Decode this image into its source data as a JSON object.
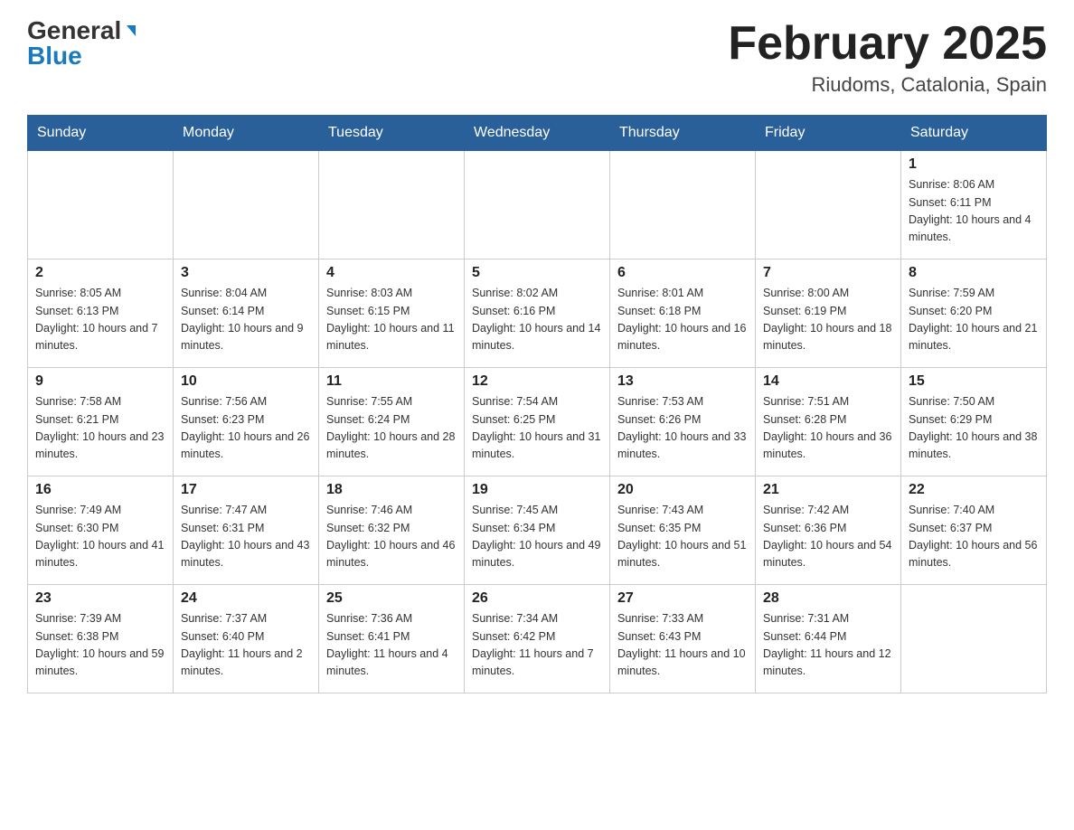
{
  "header": {
    "logo_general": "General",
    "logo_blue": "Blue",
    "month_title": "February 2025",
    "location": "Riudoms, Catalonia, Spain"
  },
  "days_of_week": [
    "Sunday",
    "Monday",
    "Tuesday",
    "Wednesday",
    "Thursday",
    "Friday",
    "Saturday"
  ],
  "weeks": [
    [
      {
        "day": "",
        "info": ""
      },
      {
        "day": "",
        "info": ""
      },
      {
        "day": "",
        "info": ""
      },
      {
        "day": "",
        "info": ""
      },
      {
        "day": "",
        "info": ""
      },
      {
        "day": "",
        "info": ""
      },
      {
        "day": "1",
        "info": "Sunrise: 8:06 AM\nSunset: 6:11 PM\nDaylight: 10 hours and 4 minutes."
      }
    ],
    [
      {
        "day": "2",
        "info": "Sunrise: 8:05 AM\nSunset: 6:13 PM\nDaylight: 10 hours and 7 minutes."
      },
      {
        "day": "3",
        "info": "Sunrise: 8:04 AM\nSunset: 6:14 PM\nDaylight: 10 hours and 9 minutes."
      },
      {
        "day": "4",
        "info": "Sunrise: 8:03 AM\nSunset: 6:15 PM\nDaylight: 10 hours and 11 minutes."
      },
      {
        "day": "5",
        "info": "Sunrise: 8:02 AM\nSunset: 6:16 PM\nDaylight: 10 hours and 14 minutes."
      },
      {
        "day": "6",
        "info": "Sunrise: 8:01 AM\nSunset: 6:18 PM\nDaylight: 10 hours and 16 minutes."
      },
      {
        "day": "7",
        "info": "Sunrise: 8:00 AM\nSunset: 6:19 PM\nDaylight: 10 hours and 18 minutes."
      },
      {
        "day": "8",
        "info": "Sunrise: 7:59 AM\nSunset: 6:20 PM\nDaylight: 10 hours and 21 minutes."
      }
    ],
    [
      {
        "day": "9",
        "info": "Sunrise: 7:58 AM\nSunset: 6:21 PM\nDaylight: 10 hours and 23 minutes."
      },
      {
        "day": "10",
        "info": "Sunrise: 7:56 AM\nSunset: 6:23 PM\nDaylight: 10 hours and 26 minutes."
      },
      {
        "day": "11",
        "info": "Sunrise: 7:55 AM\nSunset: 6:24 PM\nDaylight: 10 hours and 28 minutes."
      },
      {
        "day": "12",
        "info": "Sunrise: 7:54 AM\nSunset: 6:25 PM\nDaylight: 10 hours and 31 minutes."
      },
      {
        "day": "13",
        "info": "Sunrise: 7:53 AM\nSunset: 6:26 PM\nDaylight: 10 hours and 33 minutes."
      },
      {
        "day": "14",
        "info": "Sunrise: 7:51 AM\nSunset: 6:28 PM\nDaylight: 10 hours and 36 minutes."
      },
      {
        "day": "15",
        "info": "Sunrise: 7:50 AM\nSunset: 6:29 PM\nDaylight: 10 hours and 38 minutes."
      }
    ],
    [
      {
        "day": "16",
        "info": "Sunrise: 7:49 AM\nSunset: 6:30 PM\nDaylight: 10 hours and 41 minutes."
      },
      {
        "day": "17",
        "info": "Sunrise: 7:47 AM\nSunset: 6:31 PM\nDaylight: 10 hours and 43 minutes."
      },
      {
        "day": "18",
        "info": "Sunrise: 7:46 AM\nSunset: 6:32 PM\nDaylight: 10 hours and 46 minutes."
      },
      {
        "day": "19",
        "info": "Sunrise: 7:45 AM\nSunset: 6:34 PM\nDaylight: 10 hours and 49 minutes."
      },
      {
        "day": "20",
        "info": "Sunrise: 7:43 AM\nSunset: 6:35 PM\nDaylight: 10 hours and 51 minutes."
      },
      {
        "day": "21",
        "info": "Sunrise: 7:42 AM\nSunset: 6:36 PM\nDaylight: 10 hours and 54 minutes."
      },
      {
        "day": "22",
        "info": "Sunrise: 7:40 AM\nSunset: 6:37 PM\nDaylight: 10 hours and 56 minutes."
      }
    ],
    [
      {
        "day": "23",
        "info": "Sunrise: 7:39 AM\nSunset: 6:38 PM\nDaylight: 10 hours and 59 minutes."
      },
      {
        "day": "24",
        "info": "Sunrise: 7:37 AM\nSunset: 6:40 PM\nDaylight: 11 hours and 2 minutes."
      },
      {
        "day": "25",
        "info": "Sunrise: 7:36 AM\nSunset: 6:41 PM\nDaylight: 11 hours and 4 minutes."
      },
      {
        "day": "26",
        "info": "Sunrise: 7:34 AM\nSunset: 6:42 PM\nDaylight: 11 hours and 7 minutes."
      },
      {
        "day": "27",
        "info": "Sunrise: 7:33 AM\nSunset: 6:43 PM\nDaylight: 11 hours and 10 minutes."
      },
      {
        "day": "28",
        "info": "Sunrise: 7:31 AM\nSunset: 6:44 PM\nDaylight: 11 hours and 12 minutes."
      },
      {
        "day": "",
        "info": ""
      }
    ]
  ]
}
